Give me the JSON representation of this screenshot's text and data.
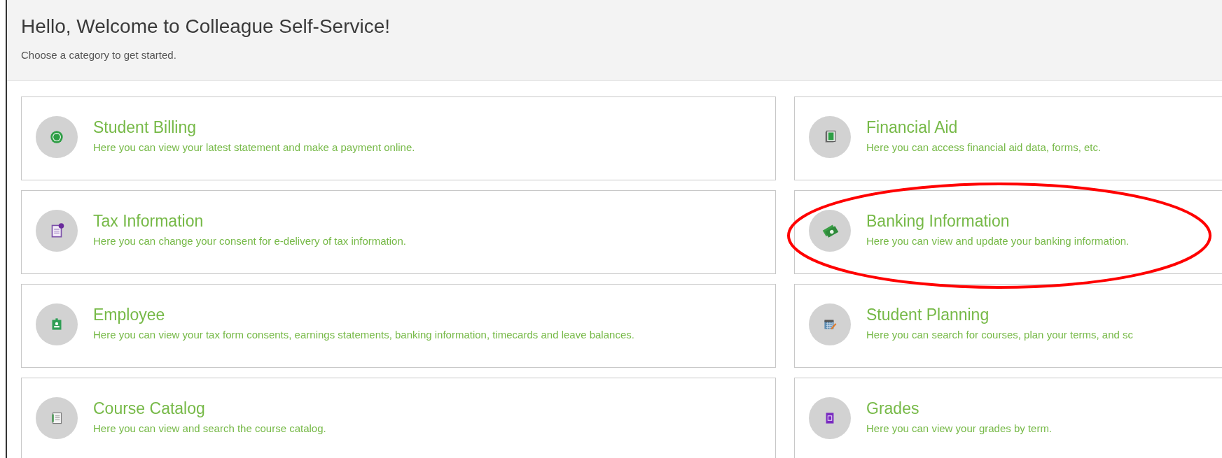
{
  "header": {
    "title": "Hello, Welcome to Colleague Self-Service!",
    "subtitle": "Choose a category to get started."
  },
  "categories": [
    {
      "kind": "billing",
      "title": "Student Billing",
      "description": "Here you can view your latest statement and make a payment online."
    },
    {
      "kind": "aid",
      "title": "Financial Aid",
      "description": "Here you can access financial aid data, forms, etc."
    },
    {
      "kind": "tax",
      "title": "Tax Information",
      "description": "Here you can change your consent for e-delivery of tax information."
    },
    {
      "kind": "banking",
      "title": "Banking Information",
      "description": "Here you can view and update your banking information."
    },
    {
      "kind": "employee",
      "title": "Employee",
      "description": "Here you can view your tax form consents, earnings statements, banking information, timecards and leave balances."
    },
    {
      "kind": "planning",
      "title": "Student Planning",
      "description": "Here you can search for courses, plan your terms, and sc"
    },
    {
      "kind": "catalog",
      "title": "Course Catalog",
      "description": "Here you can view and search the course catalog."
    },
    {
      "kind": "grades",
      "title": "Grades",
      "description": "Here you can view your grades by term."
    }
  ],
  "annotation": {
    "kind": "ellipse",
    "color": "#ff0000"
  }
}
